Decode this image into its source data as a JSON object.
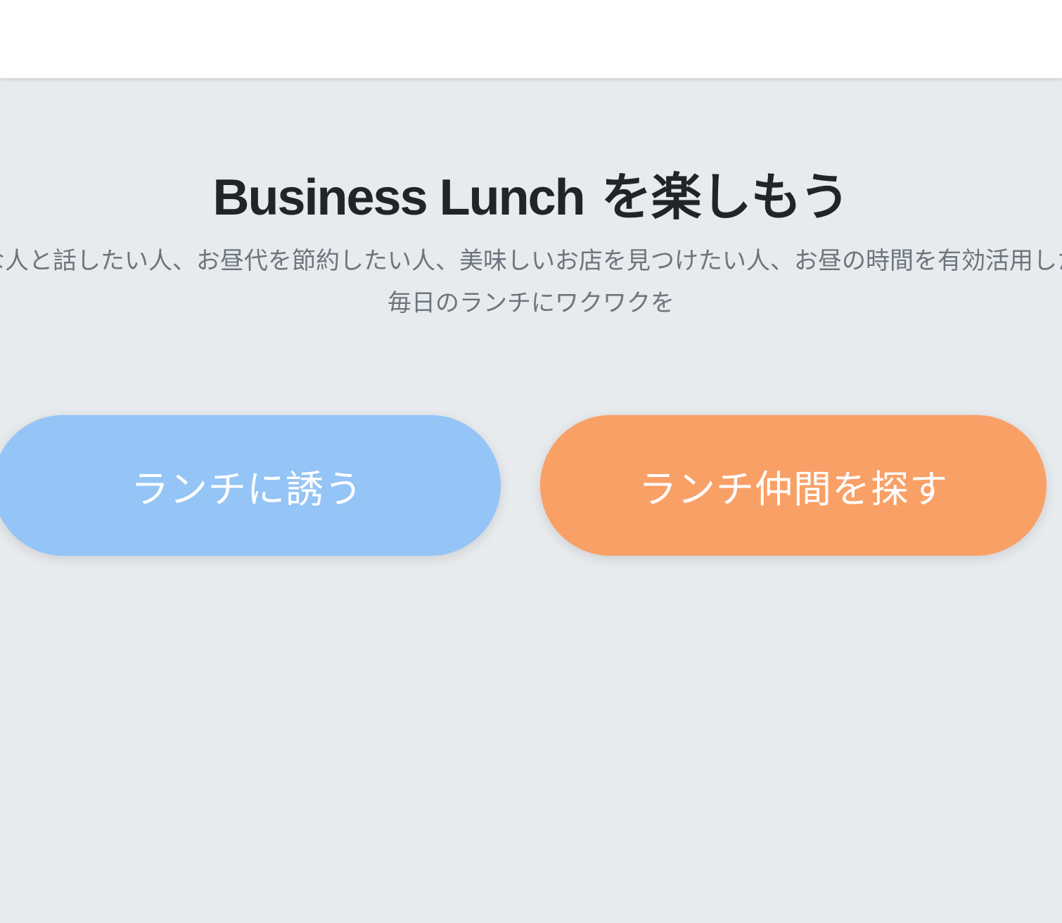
{
  "header": {},
  "hero": {
    "title_latin": "Business Lunch",
    "title_jp": " を楽しもう",
    "tagline_line1": "色々な人と話したい人、お昼代を節約したい人、美味しいお店を見つけたい人、お昼の時間を有効活用したい人",
    "tagline_line2": "毎日のランチにワクワクを"
  },
  "actions": {
    "invite_label": "ランチに誘う",
    "find_label": "ランチ仲間を探す"
  },
  "colors": {
    "background": "#e8ebee",
    "invite_button": "#95c4f6",
    "find_button": "#f9a067",
    "title_text": "#212529",
    "tagline_text": "#6c757d"
  }
}
